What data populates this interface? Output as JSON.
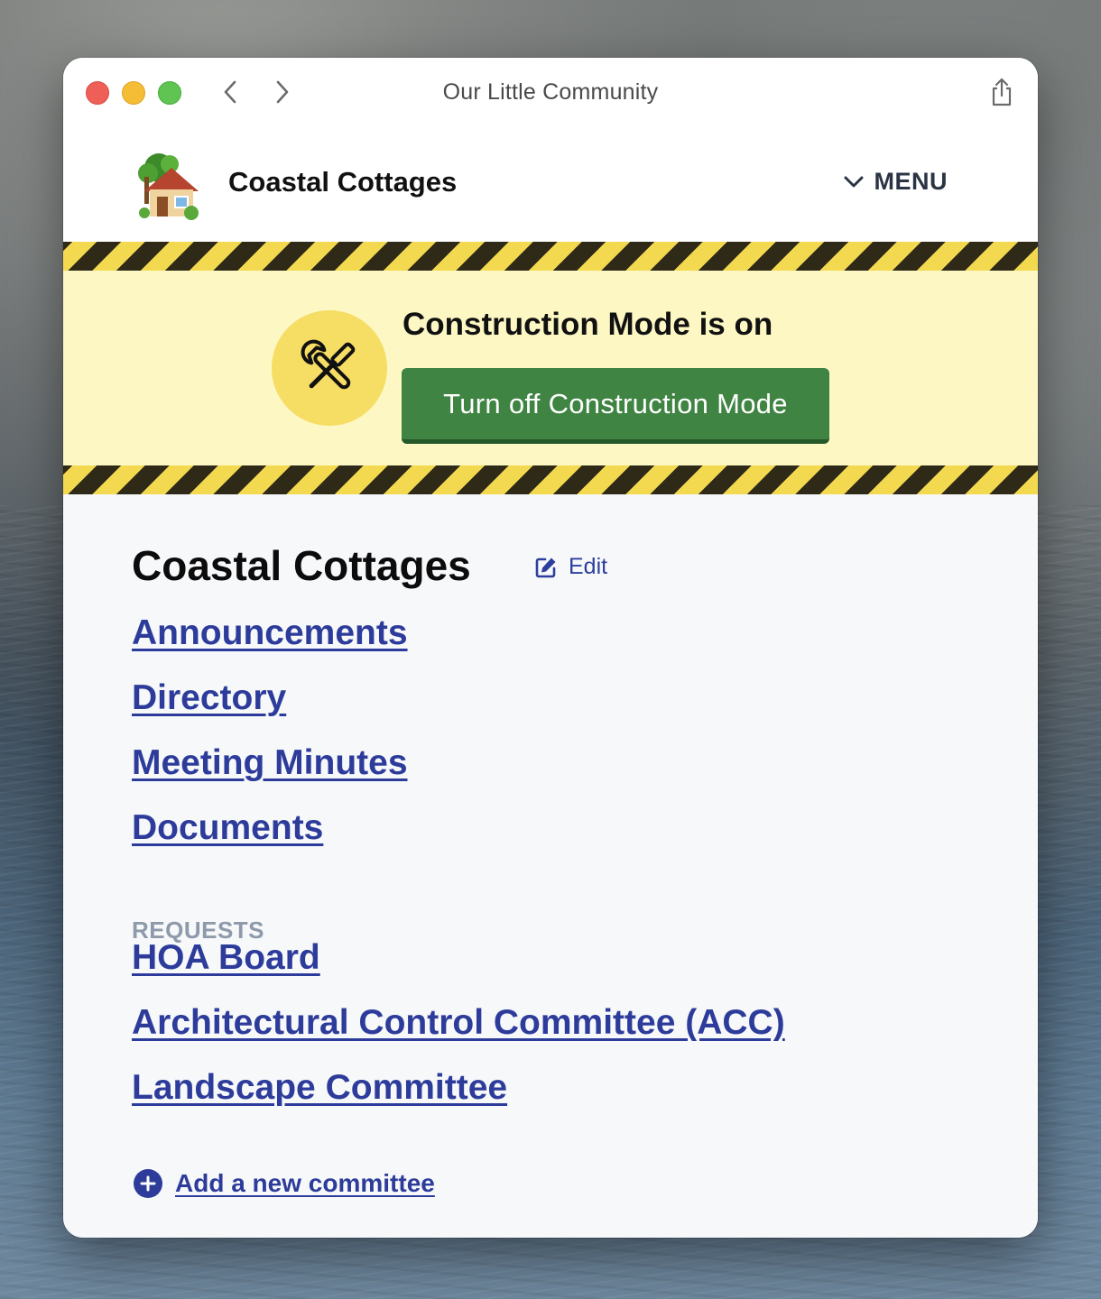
{
  "window": {
    "title": "Our Little Community"
  },
  "header": {
    "site_name": "Coastal Cottages",
    "menu_label": "MENU",
    "logo_icon": "house-with-garden-icon"
  },
  "banner": {
    "title": "Construction Mode is on",
    "button_label": "Turn off Construction Mode",
    "icon": "tools-icon"
  },
  "main": {
    "title": "Coastal Cottages",
    "edit_label": "Edit",
    "links": [
      {
        "label": "Announcements"
      },
      {
        "label": "Directory"
      },
      {
        "label": "Meeting Minutes"
      },
      {
        "label": "Documents"
      }
    ],
    "requests_heading": "REQUESTS",
    "requests": [
      {
        "label": "HOA Board"
      },
      {
        "label": "Architectural Control Committee (ACC)"
      },
      {
        "label": "Landscape Committee"
      }
    ],
    "add_committee_label": "Add a new committee"
  },
  "colors": {
    "link": "#2d3c9b",
    "button_green": "#3f8442",
    "banner_bg": "#fdf7c4",
    "hazard_yellow": "#f3d94f"
  }
}
